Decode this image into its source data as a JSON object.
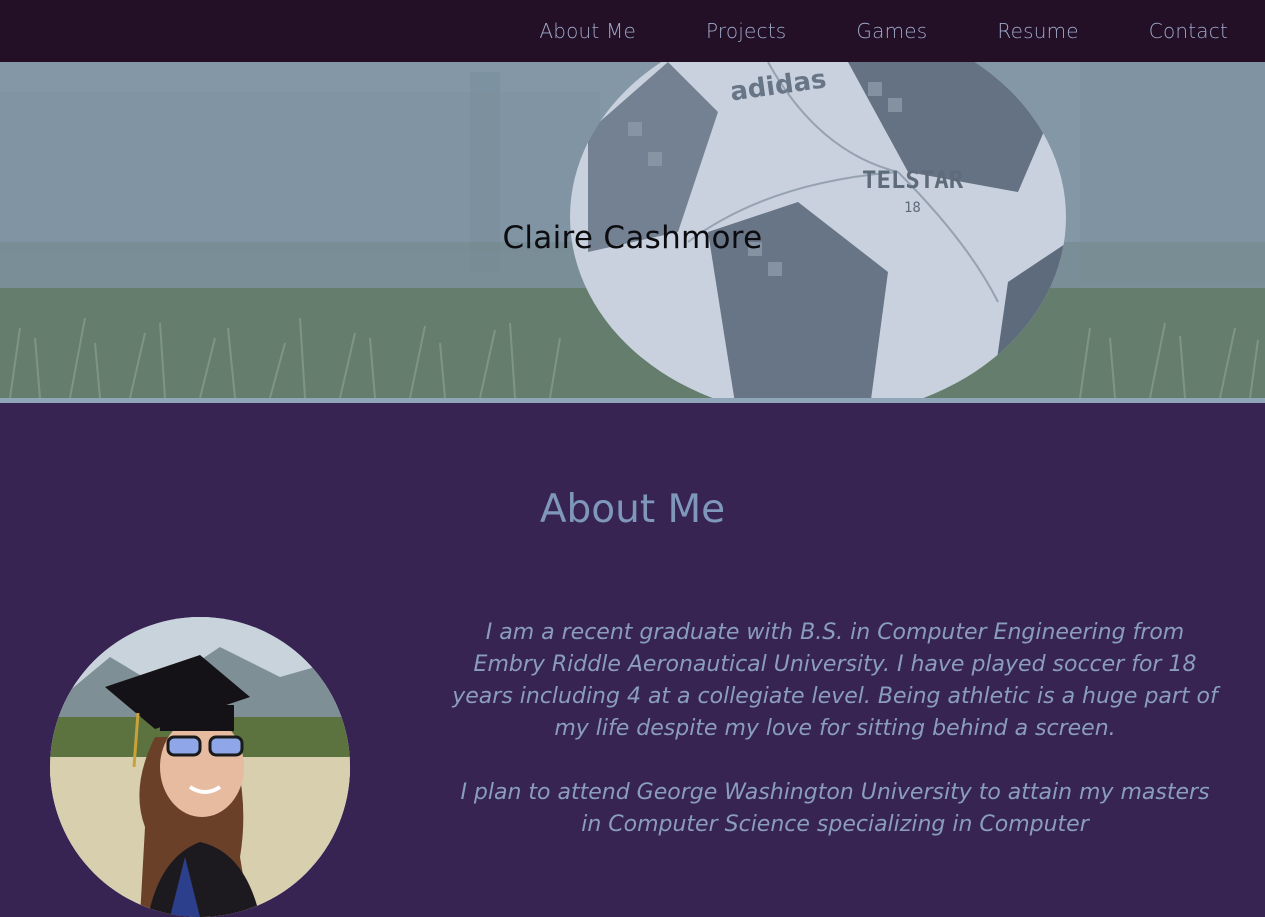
{
  "nav": {
    "items": [
      {
        "label": "About Me"
      },
      {
        "label": "Projects"
      },
      {
        "label": "Games"
      },
      {
        "label": "Resume"
      },
      {
        "label": "Contact"
      }
    ]
  },
  "hero": {
    "title": "Claire Cashmore",
    "ball_brand": "adidas",
    "ball_model": "TELSTAR",
    "ball_year": "18"
  },
  "about": {
    "heading": "About Me",
    "paragraph_1": "I am a recent graduate with B.S. in Computer Engineering from Embry Riddle Aeronautical University. I have played soccer for 18 years including 4 at a collegiate level. Being athletic is a huge part of my life despite my love for sitting behind a screen.",
    "paragraph_2": "I plan to attend George Washington University to attain my masters in Computer Science specializing in Computer"
  },
  "colors": {
    "nav_bg": "#231026",
    "nav_text": "#9ea9c9",
    "section_bg": "#372453",
    "heading": "#7f97bb",
    "body_text": "#8a9dc0",
    "accent_line": "#8fa5b8"
  }
}
